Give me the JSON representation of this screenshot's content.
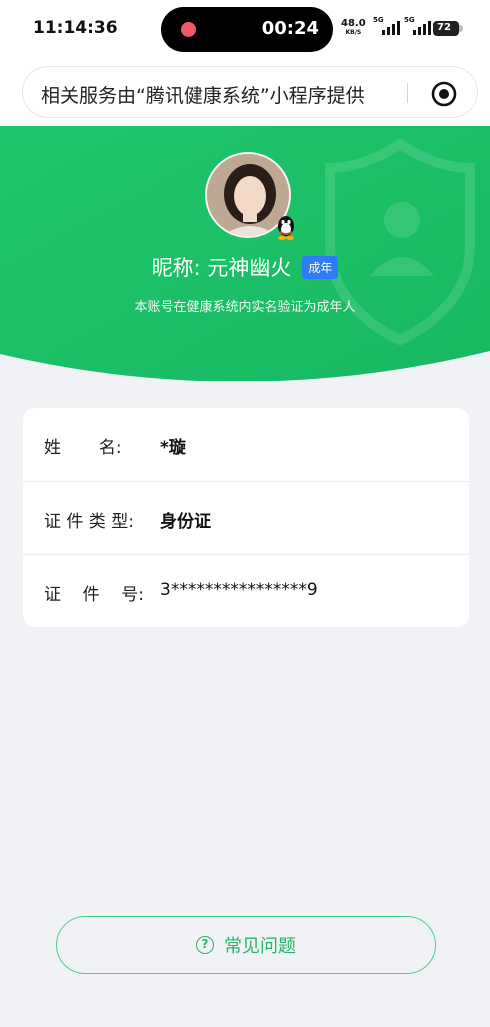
{
  "status_bar": {
    "time": "11:14:36",
    "recording_time": "00:24",
    "net_speed": "48.0",
    "net_speed_unit": "KB/S",
    "sim1_tag": "5G",
    "sim2_tag": "5G",
    "battery": "72"
  },
  "mini_program_bar": {
    "text": "相关服务由“腾讯健康系统”小程序提供"
  },
  "profile": {
    "nickname": "昵称: 元神幽火",
    "adult_tag": "成年",
    "verify_text": "本账号在健康系统内实名验证为成年人"
  },
  "info": {
    "rows": [
      {
        "label": "姓       名:",
        "value": "*璇"
      },
      {
        "label": "证 件 类 型:",
        "value": "身份证"
      },
      {
        "label": "证    件    号:",
        "value": "3****************9"
      }
    ]
  },
  "faq": {
    "icon": "?",
    "label": "常见问题"
  },
  "colors": {
    "brand_green": "#1fc46b",
    "tag_blue": "#2f7bf5",
    "faq_green": "#27b46b"
  }
}
